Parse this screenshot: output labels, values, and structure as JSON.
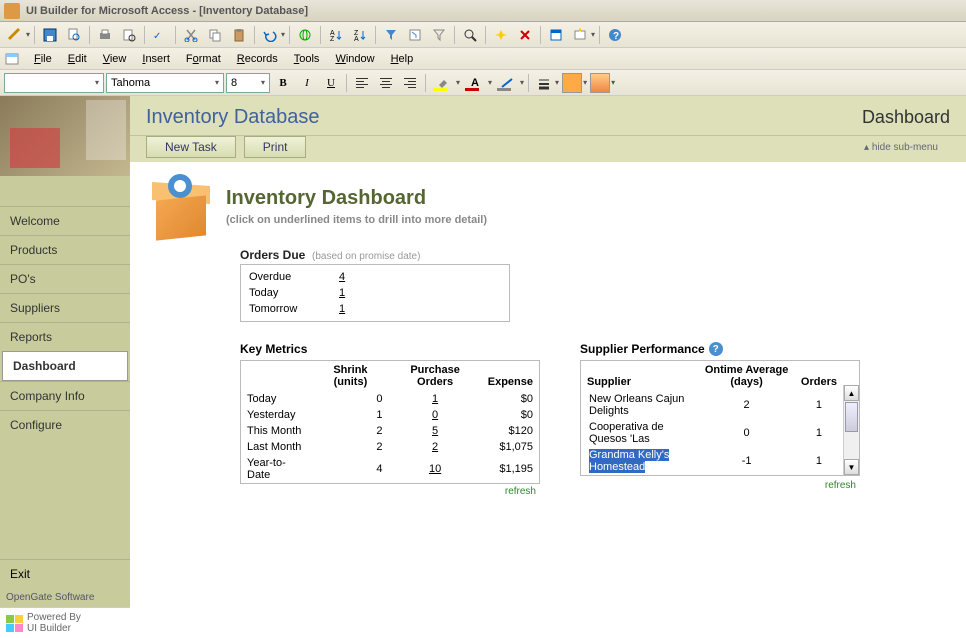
{
  "window": {
    "title": "UI Builder for Microsoft Access - [Inventory Database]"
  },
  "menu": {
    "file": "File",
    "edit": "Edit",
    "view": "View",
    "insert": "Insert",
    "format": "Format",
    "records": "Records",
    "tools": "Tools",
    "window": "Window",
    "help": "Help"
  },
  "format_toolbar": {
    "font": "Tahoma",
    "size": "8",
    "bold": "B",
    "italic": "I",
    "underline": "U",
    "font_letter": "A"
  },
  "page": {
    "title": "Inventory Database",
    "section": "Dashboard",
    "new_task": "New Task",
    "print": "Print",
    "hide_sub": "hide sub-menu"
  },
  "nav": {
    "welcome": "Welcome",
    "products": "Products",
    "pos": "PO's",
    "suppliers": "Suppliers",
    "reports": "Reports",
    "dashboard": "Dashboard",
    "company": "Company Info",
    "configure": "Configure",
    "exit": "Exit"
  },
  "brand": {
    "opengate": "OpenGate Software",
    "powered1": "Powered By",
    "powered2": "UI Builder"
  },
  "dashboard": {
    "title": "Inventory Dashboard",
    "subtitle": "(click on underlined items to drill into more detail)",
    "orders_label": "Orders Due",
    "orders_hint": "(based on promise date)",
    "orders": [
      {
        "label": "Overdue",
        "value": "4"
      },
      {
        "label": "Today",
        "value": "1"
      },
      {
        "label": "Tomorrow",
        "value": "1"
      }
    ],
    "metrics_label": "Key Metrics",
    "metrics_headers": {
      "shrink": "Shrink (units)",
      "po": "Purchase Orders",
      "expense": "Expense"
    },
    "metrics": [
      {
        "label": "Today",
        "shrink": "0",
        "po": "1",
        "expense": "$0"
      },
      {
        "label": "Yesterday",
        "shrink": "1",
        "po": "0",
        "expense": "$0"
      },
      {
        "label": "This Month",
        "shrink": "2",
        "po": "5",
        "expense": "$120"
      },
      {
        "label": "Last Month",
        "shrink": "2",
        "po": "2",
        "expense": "$1,075"
      },
      {
        "label": "Year-to-Date",
        "shrink": "4",
        "po": "10",
        "expense": "$1,195"
      }
    ],
    "supplier_label": "Supplier Performance",
    "supplier_headers": {
      "supplier": "Supplier",
      "ontime": "Ontime Average (days)",
      "orders": "Orders"
    },
    "suppliers": [
      {
        "name": "New Orleans Cajun Delights",
        "ontime": "2",
        "orders": "1"
      },
      {
        "name": "Cooperativa de Quesos 'Las",
        "ontime": "0",
        "orders": "1"
      },
      {
        "name": "Grandma Kelly's Homestead",
        "ontime": "-1",
        "orders": "1"
      }
    ],
    "refresh": "refresh"
  }
}
